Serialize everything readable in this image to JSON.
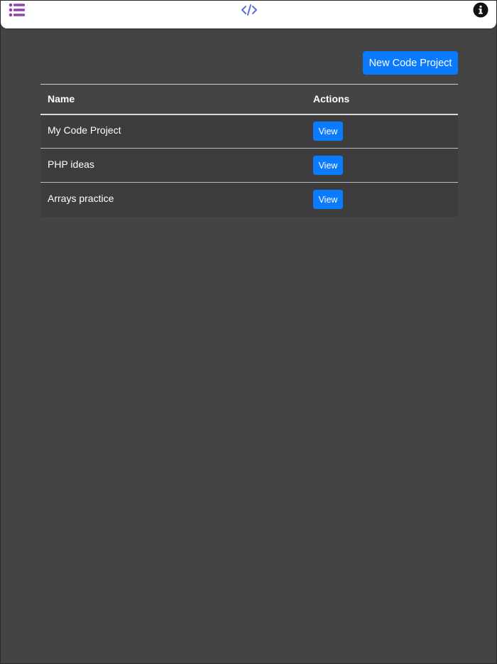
{
  "topbar": {
    "icons": {
      "menu": "list-icon",
      "code": "code-icon",
      "info": "info-circle-icon"
    },
    "colors": {
      "menu_icon": "#8e44ad",
      "code_icon": "#5b6fd8",
      "info_icon": "#111111"
    }
  },
  "actions": {
    "new_project_label": "New Code Project"
  },
  "table": {
    "headers": {
      "name": "Name",
      "actions": "Actions"
    },
    "rows": [
      {
        "name": "My Code Project",
        "action_label": "View"
      },
      {
        "name": "PHP ideas",
        "action_label": "View"
      },
      {
        "name": "Arrays practice",
        "action_label": "View"
      }
    ]
  },
  "colors": {
    "background": "#444444",
    "row_background": "#3d3d3d",
    "accent": "#0a7bff"
  }
}
